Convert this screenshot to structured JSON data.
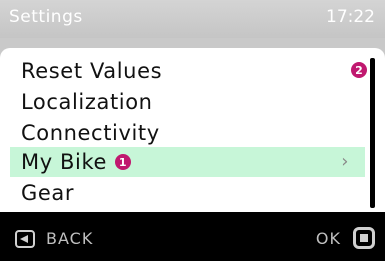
{
  "header": {
    "title": "Settings",
    "time": "17:22"
  },
  "scroll_badge": "2",
  "menu": {
    "items": [
      {
        "label": "Reset Values"
      },
      {
        "label": "Localization"
      },
      {
        "label": "Connectivity"
      },
      {
        "label": "My Bike",
        "badge": "1",
        "selected": true,
        "chevron": "›"
      },
      {
        "label": "Gear"
      }
    ]
  },
  "footer": {
    "back_label": "BACK",
    "ok_label": "OK"
  },
  "colors": {
    "selection": "#c7f6d8",
    "badge": "#c0186f",
    "header": "#c9c9c9"
  }
}
